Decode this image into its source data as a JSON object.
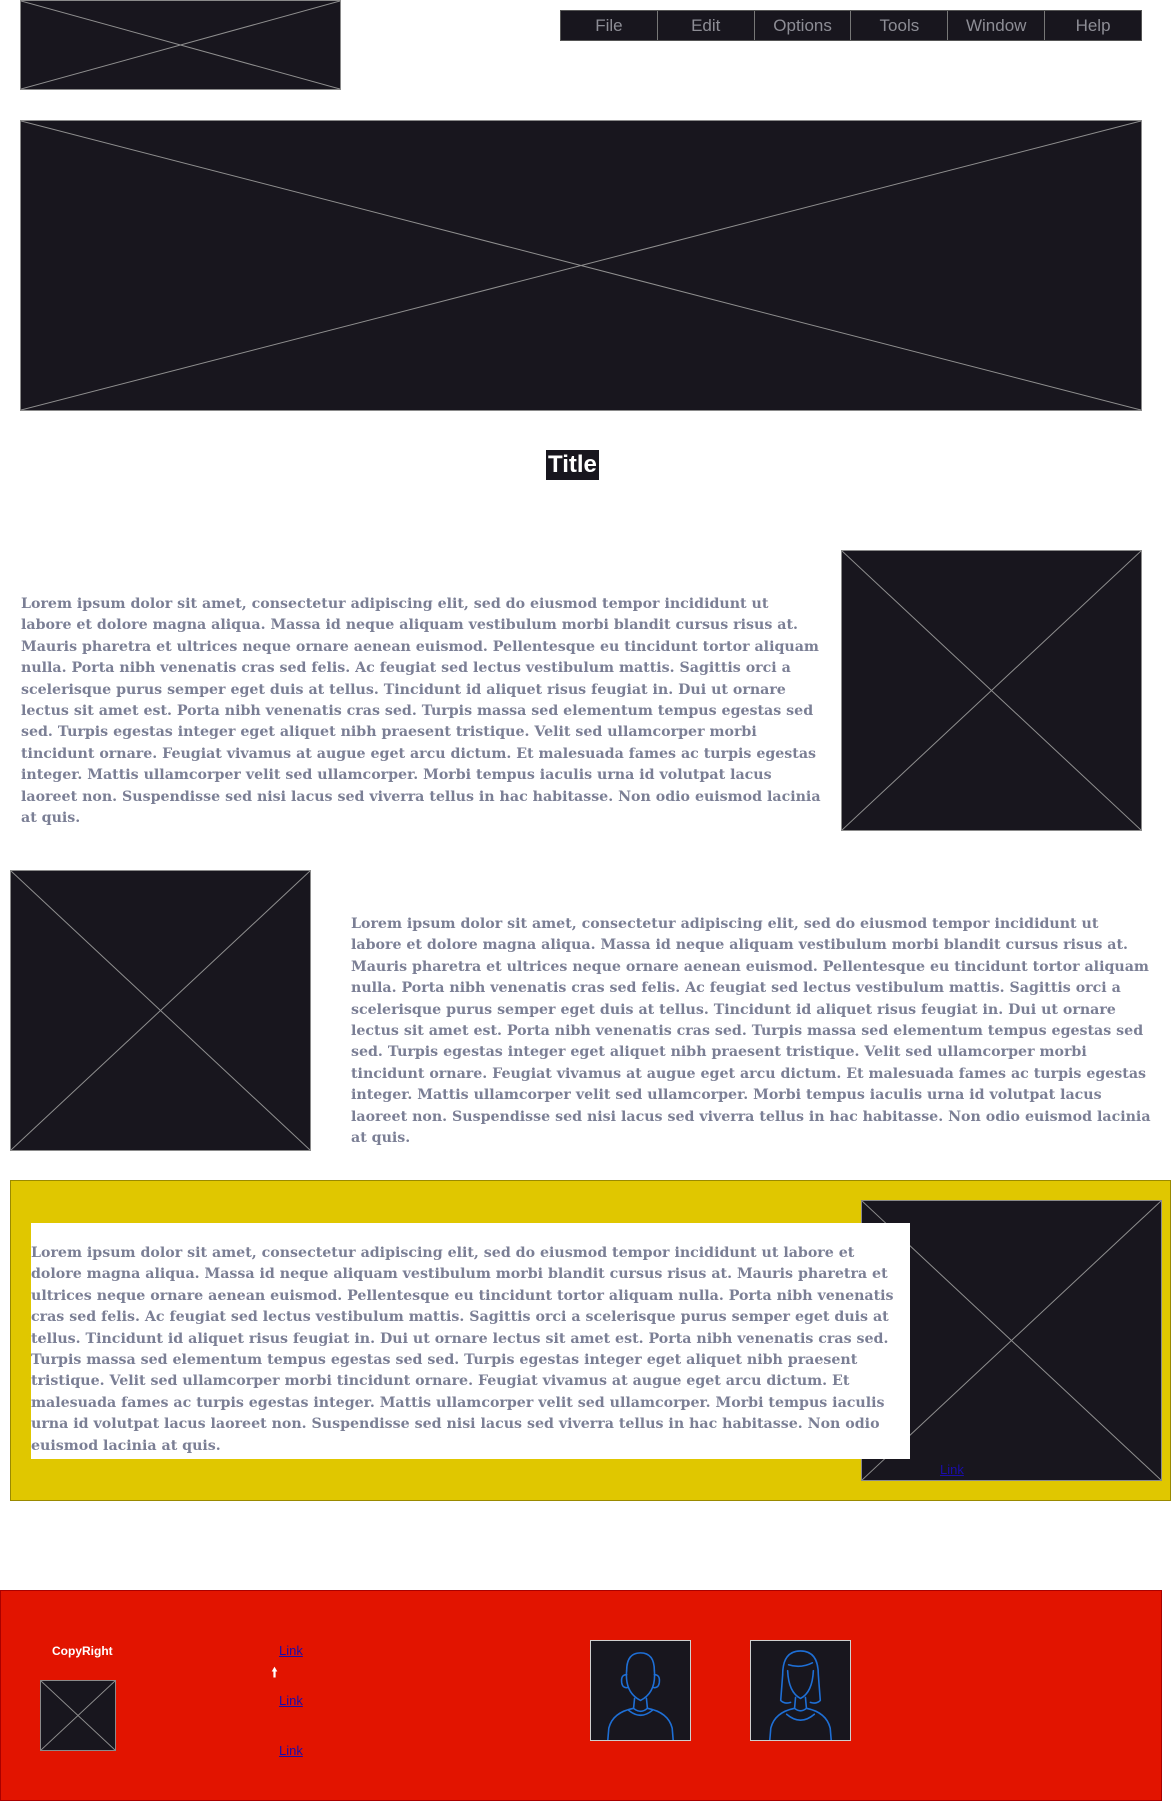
{
  "header": {
    "logo": "image-placeholder",
    "menu": [
      "File",
      "Edit",
      "Options",
      "Tools",
      "Window",
      "Help"
    ]
  },
  "hero": {
    "image": "image-placeholder"
  },
  "main": {
    "title": "Title",
    "sections": [
      {
        "text": "Lorem ipsum dolor sit amet, consectetur adipiscing elit, sed do eiusmod tempor incididunt ut labore et dolore magna aliqua. Massa id neque aliquam vestibulum morbi blandit cursus risus at. Mauris pharetra et ultrices neque ornare aenean euismod. Pellentesque eu tincidunt tortor aliquam nulla. Porta nibh venenatis cras sed felis. Ac feugiat sed lectus vestibulum mattis. Sagittis orci a scelerisque purus semper eget duis at tellus. Tincidunt id aliquet risus feugiat in. Dui ut ornare lectus sit amet est. Porta nibh venenatis cras sed. Turpis massa sed elementum tempus egestas sed sed. Turpis egestas integer eget aliquet nibh praesent tristique. Velit sed ullamcorper morbi tincidunt ornare. Feugiat vivamus at augue eget arcu dictum. Et malesuada fames ac turpis egestas integer. Mattis ullamcorper velit sed ullamcorper. Morbi tempus iaculis urna id volutpat lacus laoreet non. Suspendisse sed nisi lacus sed viverra tellus in hac habitasse. Non odio euismod lacinia at quis."
      },
      {
        "text": "Lorem ipsum dolor sit amet, consectetur adipiscing elit, sed do eiusmod tempor incididunt ut labore et dolore magna aliqua. Massa id neque aliquam vestibulum morbi blandit cursus risus at. Mauris pharetra et ultrices neque ornare aenean euismod. Pellentesque eu tincidunt tortor aliquam nulla. Porta nibh venenatis cras sed felis. Ac feugiat sed lectus vestibulum mattis. Sagittis orci a scelerisque purus semper eget duis at tellus. Tincidunt id aliquet risus feugiat in. Dui ut ornare lectus sit amet est. Porta nibh venenatis cras sed. Turpis massa sed elementum tempus egestas sed sed. Turpis egestas integer eget aliquet nibh praesent tristique. Velit sed ullamcorper morbi tincidunt ornare. Feugiat vivamus at augue eget arcu dictum. Et malesuada fames ac turpis egestas integer. Mattis ullamcorper velit sed ullamcorper. Morbi tempus iaculis urna id volutpat lacus laoreet non. Suspendisse sed nisi lacus sed viverra tellus in hac habitasse. Non odio euismod lacinia at quis."
      },
      {
        "text": "Lorem ipsum dolor sit amet, consectetur adipiscing elit, sed do eiusmod tempor incididunt ut labore et dolore magna aliqua. Massa id neque aliquam vestibulum morbi blandit cursus risus at. Mauris pharetra et ultrices neque ornare aenean euismod. Pellentesque eu tincidunt tortor aliquam nulla. Porta nibh venenatis cras sed felis. Ac feugiat sed lectus vestibulum mattis. Sagittis orci a scelerisque purus semper eget duis at tellus. Tincidunt id aliquet risus feugiat in. Dui ut ornare lectus sit amet est. Porta nibh venenatis cras sed. Turpis massa sed elementum tempus egestas sed sed. Turpis egestas integer eget aliquet nibh praesent tristique. Velit sed ullamcorper morbi tincidunt ornare. Feugiat vivamus at augue eget arcu dictum. Et malesuada fames ac turpis egestas integer. Mattis ullamcorper velit sed ullamcorper. Morbi tempus iaculis urna id volutpat lacus laoreet non. Suspendisse sed nisi lacus sed viverra tellus in hac habitasse. Non odio euismod lacinia at quis.",
        "link": "Link"
      }
    ]
  },
  "footer": {
    "copyright": "CopyRight",
    "links": [
      "Link",
      "Link",
      "Link"
    ],
    "avatars": [
      "male-avatar-icon",
      "female-avatar-icon"
    ]
  },
  "colors": {
    "dark": "#18161e",
    "yellow": "#e0c700",
    "red": "#e21400",
    "text": "#7b7f95",
    "avatar_line": "#1e6fd6"
  }
}
